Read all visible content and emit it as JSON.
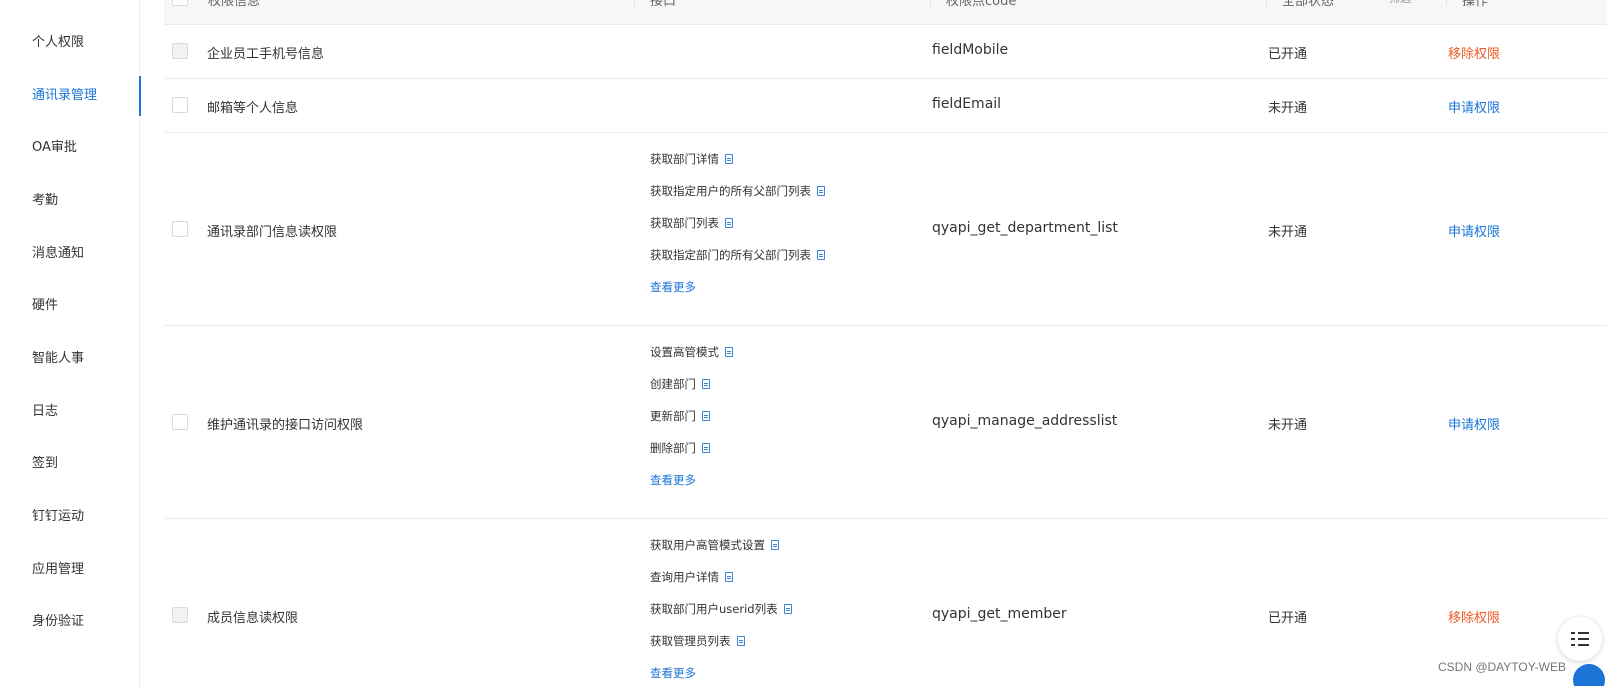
{
  "sidebar": {
    "items": [
      {
        "label": "个人权限",
        "active": false
      },
      {
        "label": "通讯录管理",
        "active": true
      },
      {
        "label": "OA审批",
        "active": false
      },
      {
        "label": "考勤",
        "active": false
      },
      {
        "label": "消息通知",
        "active": false
      },
      {
        "label": "硬件",
        "active": false
      },
      {
        "label": "智能人事",
        "active": false
      },
      {
        "label": "日志",
        "active": false
      },
      {
        "label": "签到",
        "active": false
      },
      {
        "label": "钉钉运动",
        "active": false
      },
      {
        "label": "应用管理",
        "active": false
      },
      {
        "label": "身份验证",
        "active": false
      }
    ]
  },
  "table": {
    "headers": {
      "info": "权限信息",
      "api": "接口",
      "code": "权限点code",
      "status": "全部状态",
      "filter": "筛选",
      "action": "操作"
    },
    "rows": [
      {
        "name": "企业员工手机号信息",
        "apis": [],
        "more": "",
        "code": "fieldMobile",
        "status": "已开通",
        "action": "移除权限",
        "action_type": "remove",
        "checkbox_disabled": true
      },
      {
        "name": "邮箱等个人信息",
        "apis": [],
        "more": "",
        "code": "fieldEmail",
        "status": "未开通",
        "action": "申请权限",
        "action_type": "apply",
        "checkbox_disabled": false
      },
      {
        "name": "通讯录部门信息读权限",
        "apis": [
          "获取部门详情",
          "获取指定用户的所有父部门列表",
          "获取部门列表",
          "获取指定部门的所有父部门列表"
        ],
        "more": "查看更多",
        "code": "qyapi_get_department_list",
        "status": "未开通",
        "action": "申请权限",
        "action_type": "apply",
        "checkbox_disabled": false
      },
      {
        "name": "维护通讯录的接口访问权限",
        "apis": [
          "设置高管模式",
          "创建部门",
          "更新部门",
          "删除部门"
        ],
        "more": "查看更多",
        "code": "qyapi_manage_addresslist",
        "status": "未开通",
        "action": "申请权限",
        "action_type": "apply",
        "checkbox_disabled": false
      },
      {
        "name": "成员信息读权限",
        "apis": [
          "获取用户高管模式设置",
          "查询用户详情",
          "获取部门用户userid列表",
          "获取管理员列表"
        ],
        "more": "查看更多",
        "code": "qyapi_get_member",
        "status": "已开通",
        "action": "移除权限",
        "action_type": "remove",
        "checkbox_disabled": true
      }
    ]
  },
  "watermark": "CSDN @DAYTOY-WEB",
  "colors": {
    "accent": "#1a75d6",
    "remove": "#f05a24",
    "border": "#ebebeb"
  }
}
